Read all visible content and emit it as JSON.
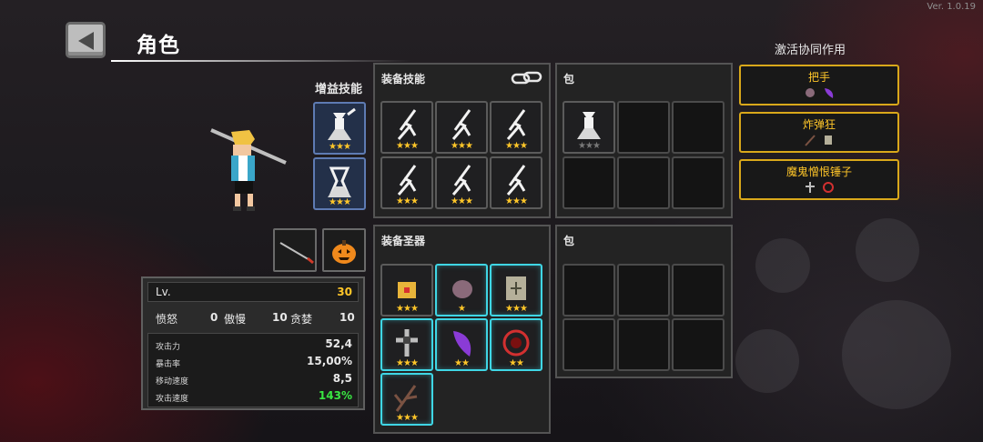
{
  "version": "Ver. 1.0.19",
  "header": {
    "title": "角色"
  },
  "boost": {
    "label": "增益技能",
    "slots": [
      {
        "icon": "ghost-knight-icon",
        "stars": "★★★"
      },
      {
        "icon": "hourglass-knight-icon",
        "stars": "★★★"
      }
    ]
  },
  "character": {
    "sprite": "character-sprite",
    "weapons": [
      "spear-icon",
      "pumpkin-icon"
    ]
  },
  "stats": {
    "level_label": "Lv.",
    "level_value": "30",
    "sins": [
      {
        "name": "愤怒",
        "value": "0"
      },
      {
        "name": "傲慢",
        "value": "10"
      },
      {
        "name": "贪婪",
        "value": "10"
      }
    ],
    "rows": [
      {
        "label": "攻击力",
        "value": "52,4"
      },
      {
        "label": "暴击率",
        "value": "15,00%"
      },
      {
        "label": "移动速度",
        "value": "8,5"
      },
      {
        "label": "攻击速度",
        "value": "143%",
        "color": "#39e642"
      }
    ]
  },
  "skills_panel": {
    "title": "装备技能",
    "link_icon": "link-icon",
    "slots": [
      {
        "icon": "sword-skill-icon",
        "stars": "★★★"
      },
      {
        "icon": "sword-skill-icon",
        "stars": "★★★"
      },
      {
        "icon": "sword-skill-icon",
        "stars": "★★★"
      },
      {
        "icon": "sword-skill-icon",
        "stars": "★★★"
      },
      {
        "icon": "sword-skill-icon",
        "stars": "★★★"
      },
      {
        "icon": "sword-skill-icon",
        "stars": "★★★"
      }
    ]
  },
  "skills_bag": {
    "title": "包",
    "slots": [
      {
        "icon": "ghost-knight-icon",
        "stars": "★★★"
      }
    ]
  },
  "relics_panel": {
    "title": "装备圣器",
    "slots": [
      {
        "icon": "treasure-chest-icon",
        "stars": "★★★"
      },
      {
        "icon": "fist-icon",
        "stars": "★"
      },
      {
        "icon": "scroll-icon",
        "stars": "★★★"
      },
      {
        "icon": "cross-icon",
        "stars": "★★★"
      },
      {
        "icon": "eggplant-icon",
        "stars": "★★"
      },
      {
        "icon": "demon-seal-icon",
        "stars": "★★"
      },
      {
        "icon": "branch-icon",
        "stars": "★★★"
      }
    ]
  },
  "relics_bag": {
    "title": "包"
  },
  "synergy": {
    "title": "激活协同作用",
    "cards": [
      {
        "name": "把手",
        "icons": [
          "fist-icon",
          "eggplant-icon"
        ]
      },
      {
        "name": "炸弹狂",
        "icons": [
          "branch-icon",
          "scroll-icon"
        ]
      },
      {
        "name": "魔鬼憎恨锤子",
        "icons": [
          "cross-icon",
          "demon-seal-icon"
        ]
      }
    ]
  },
  "colors": {
    "gold": "#ffc629",
    "cyan": "#3fd6e5",
    "skill_blue": "#5e7bb3",
    "green": "#39e642"
  }
}
